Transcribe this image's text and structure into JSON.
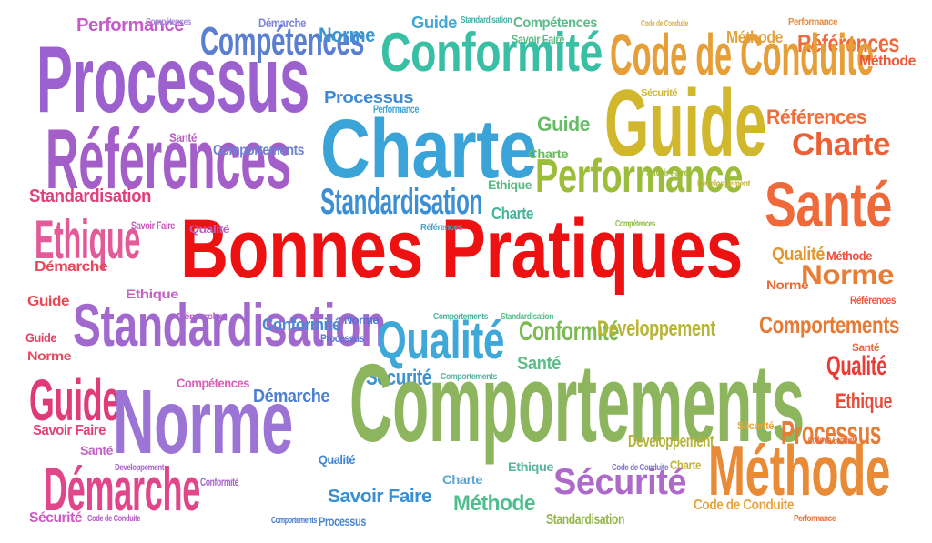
{
  "title": "Bonnes Pratiques",
  "words": [
    {
      "id": "title",
      "text": "Bonnes Pratiques",
      "color": "#ee1111"
    },
    {
      "id": "w1",
      "text": "Performance",
      "color": "#c75ac9"
    },
    {
      "id": "w2",
      "text": "Compétences",
      "color": "#a58ad6"
    },
    {
      "id": "w3",
      "text": "Démarche",
      "color": "#7d86d8"
    },
    {
      "id": "w4",
      "text": "Guide",
      "color": "#41a7d6"
    },
    {
      "id": "w5",
      "text": "Standardisation",
      "color": "#42b3a8"
    },
    {
      "id": "w6",
      "text": "Compétences",
      "color": "#5cbd88"
    },
    {
      "id": "w7",
      "text": "Code de Conduite",
      "color": "#d8b24a"
    },
    {
      "id": "w8",
      "text": "Méthode",
      "color": "#e3a33c"
    },
    {
      "id": "w9",
      "text": "Performance",
      "color": "#e98a3b"
    },
    {
      "id": "w10",
      "text": "Compétences",
      "color": "#5a7fd0"
    },
    {
      "id": "w11",
      "text": "Norme",
      "color": "#3a96d3"
    },
    {
      "id": "w12",
      "text": "Savoir Faire",
      "color": "#62bc86"
    },
    {
      "id": "w13",
      "text": "Références",
      "color": "#ee6a3a"
    },
    {
      "id": "w14",
      "text": "Processus",
      "color": "#9d61cf"
    },
    {
      "id": "w15",
      "text": "Conformité",
      "color": "#38bfa4"
    },
    {
      "id": "w16",
      "text": "Code de Conduite",
      "color": "#e69f38"
    },
    {
      "id": "w17",
      "text": "Méthode",
      "color": "#ee5838"
    },
    {
      "id": "w18",
      "text": "Processus",
      "color": "#3f8ad0"
    },
    {
      "id": "w19",
      "text": "Performance",
      "color": "#3fa2d2"
    },
    {
      "id": "w20",
      "text": "Guide",
      "color": "#d0b72c"
    },
    {
      "id": "w21",
      "text": "Sécurité",
      "color": "#d0b735"
    },
    {
      "id": "w22",
      "text": "Références",
      "color": "#ef6e3c"
    },
    {
      "id": "w23",
      "text": "Charte",
      "color": "#3aa3d7"
    },
    {
      "id": "w24",
      "text": "Guide",
      "color": "#68bc68"
    },
    {
      "id": "w25",
      "text": "Références",
      "color": "#a45ec8"
    },
    {
      "id": "w26",
      "text": "Santé",
      "color": "#ba5fc0"
    },
    {
      "id": "w27",
      "text": "Comportements",
      "color": "#6e80d2"
    },
    {
      "id": "w28",
      "text": "Charte",
      "color": "#ec6036"
    },
    {
      "id": "w29",
      "text": "Charte",
      "color": "#6cbc5e"
    },
    {
      "id": "w30",
      "text": "Performance",
      "color": "#9cbd3a"
    },
    {
      "id": "w31",
      "text": "Savoir Faire",
      "color": "#9fbb3a"
    },
    {
      "id": "w32",
      "text": "Developpement",
      "color": "#c3b43a"
    },
    {
      "id": "w33",
      "text": "Standardisation",
      "color": "#e0417a"
    },
    {
      "id": "w34",
      "text": "Santé",
      "color": "#ee6a3a"
    },
    {
      "id": "w35",
      "text": "Standardisation",
      "color": "#3d8fd3"
    },
    {
      "id": "w36",
      "text": "Ethique",
      "color": "#5abb86"
    },
    {
      "id": "w37",
      "text": "Ethique",
      "color": "#e35a99"
    },
    {
      "id": "w38",
      "text": "Savoir Faire",
      "color": "#c959b8"
    },
    {
      "id": "w39",
      "text": "Qualité",
      "color": "#b75fc8"
    },
    {
      "id": "w40",
      "text": "Références",
      "color": "#4da5c9"
    },
    {
      "id": "w41",
      "text": "Charte",
      "color": "#46b59b"
    },
    {
      "id": "w42",
      "text": "Compétences",
      "color": "#8ebb3f"
    },
    {
      "id": "w43",
      "text": "Démarche",
      "color": "#e8485a"
    },
    {
      "id": "w44",
      "text": "Qualité",
      "color": "#e3972c"
    },
    {
      "id": "w45",
      "text": "Méthode",
      "color": "#ee4f3a"
    },
    {
      "id": "w46",
      "text": "Ethique",
      "color": "#c463c5"
    },
    {
      "id": "w47",
      "text": "Norme",
      "color": "#ec6a36"
    },
    {
      "id": "w48",
      "text": "Norme",
      "color": "#e87d36"
    },
    {
      "id": "w49",
      "text": "Références",
      "color": "#ee5838"
    },
    {
      "id": "w50",
      "text": "Guide",
      "color": "#e64b55"
    },
    {
      "id": "w51",
      "text": "Démarche",
      "color": "#bb5cc4"
    },
    {
      "id": "w52",
      "text": "Standardisation",
      "color": "#a169cd"
    },
    {
      "id": "w53",
      "text": "Conformité",
      "color": "#4b8ad1"
    },
    {
      "id": "w54",
      "text": "Norme",
      "color": "#4e74d0"
    },
    {
      "id": "w55",
      "text": "Qualité",
      "color": "#3ea8d8"
    },
    {
      "id": "w56",
      "text": "Comportements",
      "color": "#46b49c"
    },
    {
      "id": "w57",
      "text": "Standardisation",
      "color": "#5bbd8d"
    },
    {
      "id": "w58",
      "text": "Conformité",
      "color": "#7bbb50"
    },
    {
      "id": "w59",
      "text": "Developpement",
      "color": "#b8b535"
    },
    {
      "id": "w60",
      "text": "Comportements",
      "color": "#e77b36"
    },
    {
      "id": "w61",
      "text": "Guide",
      "color": "#e24266"
    },
    {
      "id": "w62",
      "text": "Processus",
      "color": "#5b75d2"
    },
    {
      "id": "w63",
      "text": "Santé",
      "color": "#ee6a3a"
    },
    {
      "id": "w64",
      "text": "Qualité",
      "color": "#ea3b35"
    },
    {
      "id": "w65",
      "text": "Norme",
      "color": "#e24e63"
    },
    {
      "id": "w66",
      "text": "Santé",
      "color": "#5dbd89"
    },
    {
      "id": "w67",
      "text": "Sécurité",
      "color": "#3c93d4"
    },
    {
      "id": "w68",
      "text": "Comportements",
      "color": "#56b5a1"
    },
    {
      "id": "w69",
      "text": "Comportements",
      "color": "#8cb55e"
    },
    {
      "id": "w70",
      "text": "Guide",
      "color": "#df3b79"
    },
    {
      "id": "w71",
      "text": "Compétences",
      "color": "#d85fb6"
    },
    {
      "id": "w72",
      "text": "Démarche",
      "color": "#4d7fd1"
    },
    {
      "id": "w73",
      "text": "Norme",
      "color": "#9c74d6"
    },
    {
      "id": "w74",
      "text": "Ethique",
      "color": "#e74b38"
    },
    {
      "id": "w75",
      "text": "Savoir Faire",
      "color": "#e3427c"
    },
    {
      "id": "w76",
      "text": "Sécurité",
      "color": "#e8a43a"
    },
    {
      "id": "w77",
      "text": "Processus",
      "color": "#e57d37"
    },
    {
      "id": "w78",
      "text": "Santé",
      "color": "#c361c8"
    },
    {
      "id": "w79",
      "text": "Developpement",
      "color": "#a864cd"
    },
    {
      "id": "w80",
      "text": "Qualité",
      "color": "#3f84d2"
    },
    {
      "id": "w81",
      "text": "Developpement",
      "color": "#b3b33d"
    },
    {
      "id": "w82",
      "text": "Code de Conduite",
      "color": "#ec6b3a"
    },
    {
      "id": "w83",
      "text": "Démarche",
      "color": "#e1468b"
    },
    {
      "id": "w84",
      "text": "Conformité",
      "color": "#a45fc9"
    },
    {
      "id": "w85",
      "text": "Charte",
      "color": "#5aa5d3"
    },
    {
      "id": "w86",
      "text": "Ethique",
      "color": "#5bb3a0"
    },
    {
      "id": "w87",
      "text": "Charte",
      "color": "#c4b43a"
    },
    {
      "id": "w88",
      "text": "Méthode",
      "color": "#e98a36"
    },
    {
      "id": "w89",
      "text": "Savoir Faire",
      "color": "#3a8fd3"
    },
    {
      "id": "w90",
      "text": "Sécurité",
      "color": "#ad6ac9"
    },
    {
      "id": "w91",
      "text": "Code de Conduite",
      "color": "#8374d3"
    },
    {
      "id": "w92",
      "text": "Méthode",
      "color": "#4fbd8d"
    },
    {
      "id": "w93",
      "text": "Sécurité",
      "color": "#cc5bc1"
    },
    {
      "id": "w94",
      "text": "Code de Conduite",
      "color": "#b35cc4"
    },
    {
      "id": "w95",
      "text": "Comportements",
      "color": "#3f79d0"
    },
    {
      "id": "w96",
      "text": "Processus",
      "color": "#4a86d3"
    },
    {
      "id": "w97",
      "text": "Standardisation",
      "color": "#94b64b"
    },
    {
      "id": "w98",
      "text": "Code de Conduite",
      "color": "#e8a43a"
    },
    {
      "id": "w99",
      "text": "Performance",
      "color": "#ea7036"
    }
  ]
}
